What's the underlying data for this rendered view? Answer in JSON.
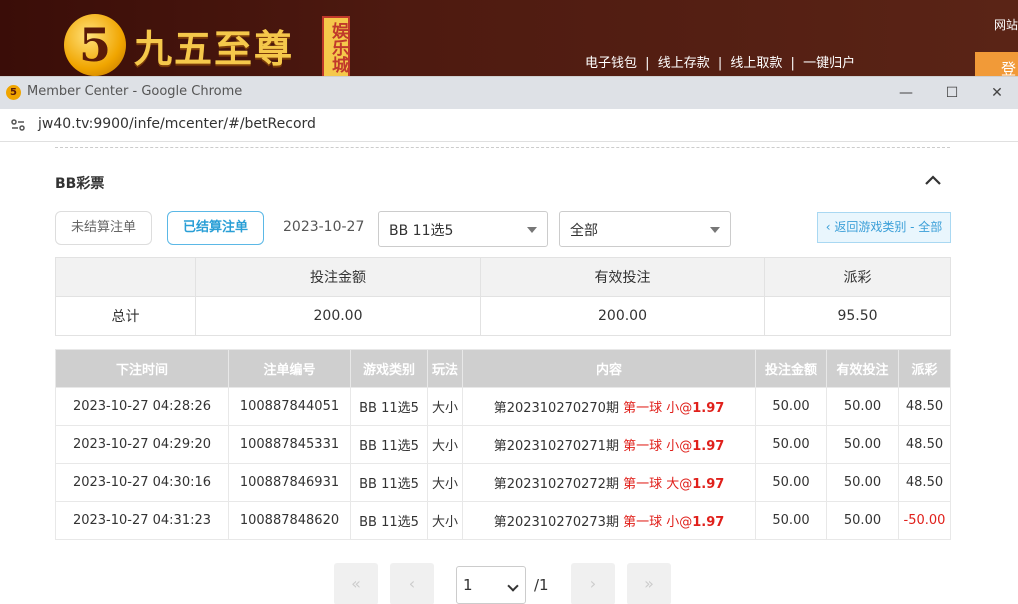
{
  "site": {
    "logo_numeral": "5",
    "logo_text": "九五至尊",
    "logo_badge": "娱乐城",
    "nav": [
      "电子钱包",
      "线上存款",
      "线上取款",
      "一键归户"
    ],
    "nav_separator": "|",
    "site_link": "网站",
    "login_label": "登"
  },
  "window": {
    "title": "Member Center - Google Chrome",
    "url": "jw40.tv:9900/infe/mcenter/#/betRecord"
  },
  "page": {
    "section_title": "BB彩票",
    "tab_unsettled": "未结算注单",
    "tab_settled": "已结算注单",
    "date": "2023-10-27",
    "game_select": "BB 11选5",
    "filter_select": "全部",
    "back_button": "‹ 返回游戏类别 - 全部"
  },
  "summary": {
    "headers": [
      "",
      "投注金额",
      "有效投注",
      "派彩"
    ],
    "row_label": "总计",
    "values": [
      "200.00",
      "200.00",
      "95.50"
    ]
  },
  "records": {
    "headers": [
      "下注时间",
      "注单编号",
      "游戏类别",
      "玩法",
      "内容",
      "投注金额",
      "有效投注",
      "派彩"
    ],
    "rows": [
      {
        "time": "2023-10-27 04:28:26",
        "id": "100887844051",
        "game": "BB 11选5",
        "play": "大小",
        "period": "第202310270270期",
        "pick": "第一球 小@",
        "odds": "1.97",
        "amount": "50.00",
        "valid": "50.00",
        "payout": "48.50"
      },
      {
        "time": "2023-10-27 04:29:20",
        "id": "100887845331",
        "game": "BB 11选5",
        "play": "大小",
        "period": "第202310270271期",
        "pick": "第一球 小@",
        "odds": "1.97",
        "amount": "50.00",
        "valid": "50.00",
        "payout": "48.50"
      },
      {
        "time": "2023-10-27 04:30:16",
        "id": "100887846931",
        "game": "BB 11选5",
        "play": "大小",
        "period": "第202310270272期",
        "pick": "第一球 大@",
        "odds": "1.97",
        "amount": "50.00",
        "valid": "50.00",
        "payout": "48.50"
      },
      {
        "time": "2023-10-27 04:31:23",
        "id": "100887848620",
        "game": "BB 11选5",
        "play": "大小",
        "period": "第202310270273期",
        "pick": "第一球 小@",
        "odds": "1.97",
        "amount": "50.00",
        "valid": "50.00",
        "payout": "-50.00"
      }
    ]
  },
  "pager": {
    "first": "«",
    "prev": "‹",
    "next": "›",
    "last": "»",
    "current": "1",
    "total": "/1"
  },
  "colors": {
    "accent": "#2a9fd6",
    "negative": "#e0201b",
    "header_gray": "#cfcfcf"
  }
}
